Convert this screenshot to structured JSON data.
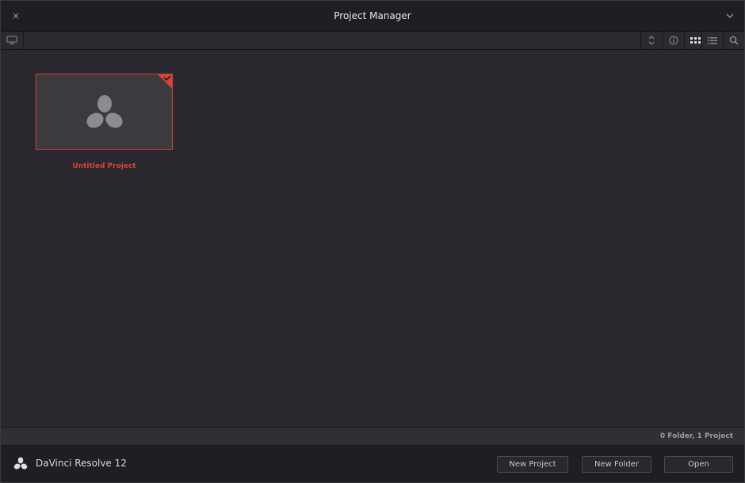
{
  "window": {
    "title": "Project Manager"
  },
  "titlebar": {
    "close_glyph": "×"
  },
  "toolbar": {
    "buttons": [
      "monitor-icon",
      "sort-icon",
      "info-icon",
      "grid-view-icon",
      "list-view-icon",
      "search-icon"
    ],
    "active_view": "grid"
  },
  "projects": [
    {
      "name": "Untitled Project",
      "selected": true
    }
  ],
  "status": {
    "text": "0 Folder, 1 Project"
  },
  "footer": {
    "app_name": "DaVinci Resolve 12",
    "new_project": "New Project",
    "new_folder": "New Folder",
    "open": "Open"
  },
  "colors": {
    "accent": "#d6433b",
    "background": "#28282e",
    "titlebar": "#1f1f23"
  }
}
